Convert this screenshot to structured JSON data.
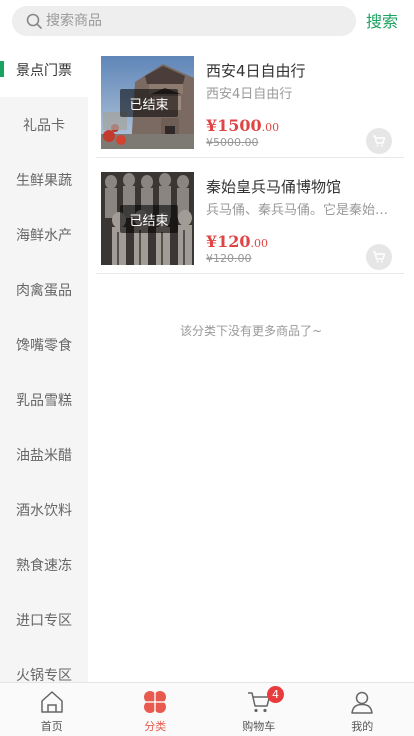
{
  "search": {
    "placeholder": "搜索商品",
    "button_label": "搜索"
  },
  "sidebar": {
    "items": [
      {
        "label": "景点门票",
        "active": true
      },
      {
        "label": "礼品卡",
        "active": false
      },
      {
        "label": "生鲜果蔬",
        "active": false
      },
      {
        "label": "海鲜水产",
        "active": false
      },
      {
        "label": "肉禽蛋品",
        "active": false
      },
      {
        "label": "馋嘴零食",
        "active": false
      },
      {
        "label": "乳品雪糕",
        "active": false
      },
      {
        "label": "油盐米醋",
        "active": false
      },
      {
        "label": "酒水饮料",
        "active": false
      },
      {
        "label": "熟食速冻",
        "active": false
      },
      {
        "label": "进口专区",
        "active": false
      },
      {
        "label": "火锅专区",
        "active": false
      }
    ]
  },
  "products": [
    {
      "title": "西安4日自由行",
      "subtitle": "西安4日自由行",
      "status": "已结束",
      "price_int": "¥1500",
      "price_dec": ".00",
      "old_price": "¥5000.00",
      "image": "city-gate-photo"
    },
    {
      "title": "秦始皇兵马俑博物馆",
      "subtitle": "兵马俑、秦兵马俑。它是秦始皇陵的一部分",
      "status": "已结束",
      "price_int": "¥120",
      "price_dec": ".00",
      "old_price": "¥120.00",
      "image": "terracotta-warriors-photo"
    }
  ],
  "footer_note": "该分类下没有更多商品了~",
  "tabbar": {
    "items": [
      {
        "label": "首页",
        "icon": "home-icon",
        "active": false
      },
      {
        "label": "分类",
        "icon": "category-icon",
        "active": true
      },
      {
        "label": "购物车",
        "icon": "cart-icon",
        "active": false,
        "badge": "4"
      },
      {
        "label": "我的",
        "icon": "user-icon",
        "active": false
      }
    ]
  },
  "colors": {
    "accent": "#1aa260",
    "price": "#e04545",
    "active_tab": "#e85a4f",
    "badge": "#e83b3b"
  }
}
